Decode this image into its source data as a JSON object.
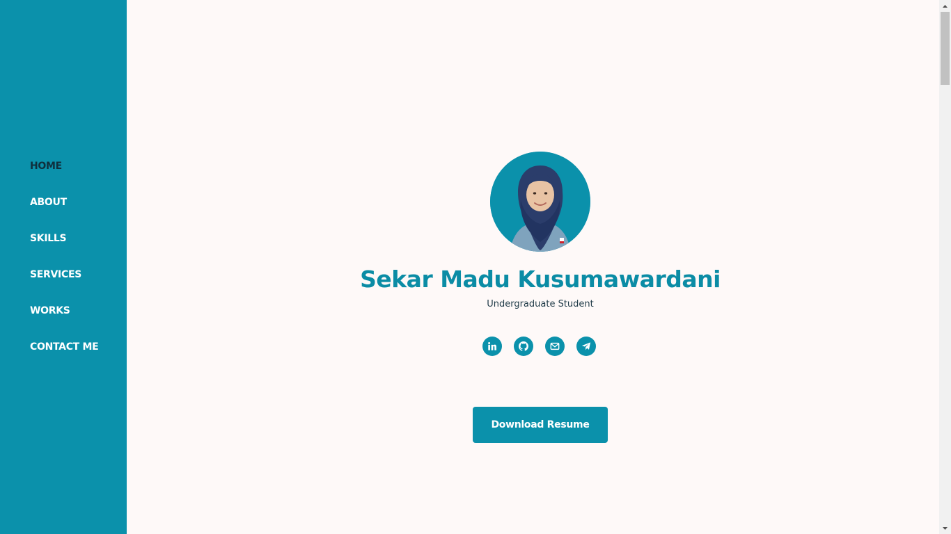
{
  "nav": {
    "items": [
      {
        "label": "HOME",
        "active": true
      },
      {
        "label": "ABOUT"
      },
      {
        "label": "SKILLS"
      },
      {
        "label": "SERVICES"
      },
      {
        "label": "WORKS"
      },
      {
        "label": "CONTACT ME"
      }
    ]
  },
  "profile": {
    "name": "Sekar Madu Kusumawardani",
    "role": "Undergraduate Student",
    "avatar_alt": "profile-photo"
  },
  "socials": [
    {
      "icon": "linkedin-icon"
    },
    {
      "icon": "github-icon"
    },
    {
      "icon": "mail-icon"
    },
    {
      "icon": "telegram-icon"
    }
  ],
  "cta": {
    "label": "Download Resume"
  },
  "colors": {
    "primary": "#0b91ab",
    "name_text": "#0b8ca5",
    "active_nav": "#0f2f3d",
    "background": "#fef9f8"
  }
}
